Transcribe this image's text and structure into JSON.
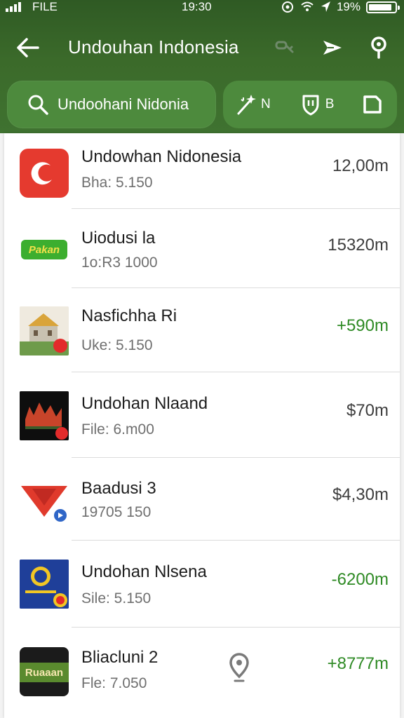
{
  "statusbar": {
    "carrier": "FILE",
    "time": "19:30",
    "battery": "19%"
  },
  "appbar": {
    "title": "Undouhan Indonesia"
  },
  "search": {
    "text": "Undoohani Nidonia"
  },
  "filters": [
    {
      "label": "N"
    },
    {
      "label": "B"
    }
  ],
  "items": [
    {
      "title": "Undowhan Nidonesia",
      "subtitle": "Bha: 5.150",
      "value": "12,00m",
      "value_color": "#3d3d3d",
      "thumb": "red-app-icon"
    },
    {
      "title": "Uiodusi la",
      "subtitle": "1o:R3 1000",
      "value": "15320m",
      "value_color": "#3d3d3d",
      "thumb": "green-label-icon",
      "thumb_text": "Pakan"
    },
    {
      "title": "Nasfichha Ri",
      "subtitle": "Uke: 5.150",
      "value": "+590m",
      "value_color": "#2e8a24",
      "thumb": "house-photo-icon"
    },
    {
      "title": "Undohan Nlaand",
      "subtitle": "File: 6.m00",
      "value": "$70m",
      "value_color": "#3d3d3d",
      "thumb": "dark-city-icon"
    },
    {
      "title": "Baadusi 3",
      "subtitle": "19705 150",
      "value": "$4,30m",
      "value_color": "#3d3d3d",
      "thumb": "red-triangle-icon"
    },
    {
      "title": "Undohan Nlsena",
      "subtitle": "Sile: 5.150",
      "value": "-6200m",
      "value_color": "#2e8a24",
      "thumb": "blue-badge-icon"
    },
    {
      "title": "Bliacluni 2",
      "subtitle": "Fle: 7.050",
      "value": "+8777m",
      "value_color": "#2e8a24",
      "thumb": "dark-card-icon",
      "thumb_text": "Ruaaan"
    }
  ]
}
